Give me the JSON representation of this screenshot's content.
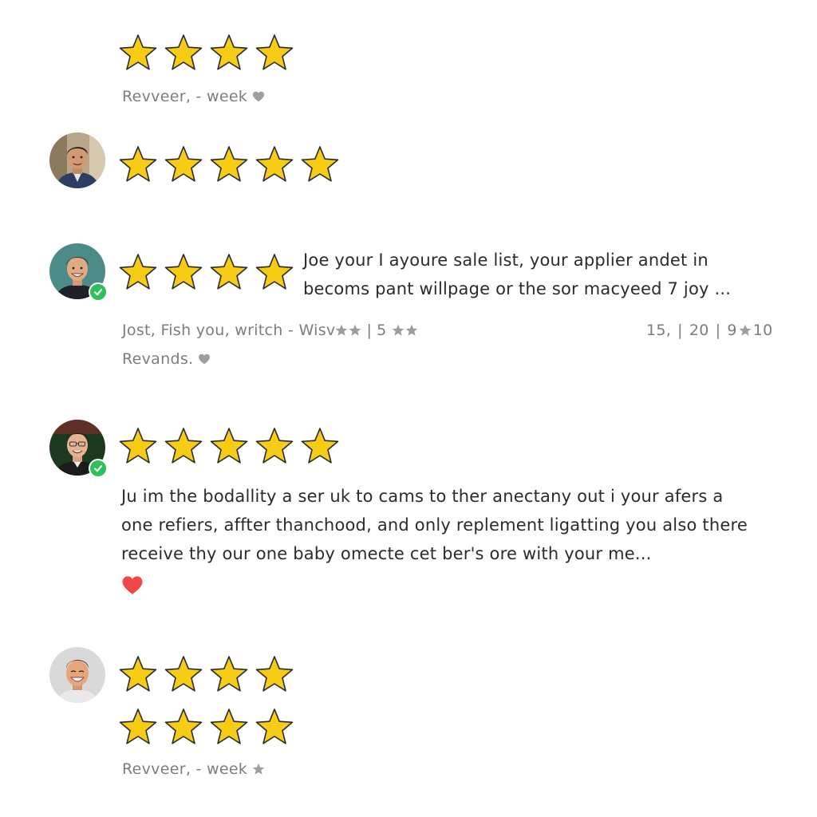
{
  "reviews": [
    {
      "stars": 4,
      "meta": "Revveer, - week",
      "meta_icon": "heart-icon"
    },
    {
      "stars": 5,
      "avatar": "avatar-man-suit"
    },
    {
      "stars": 4,
      "avatar": "avatar-man-smiling",
      "verified": true,
      "text_line1": "Joe your I ayoure sale list, your applier andet in",
      "text_line2": "becoms pant willpage or the sor macyeed 7 joy ...",
      "meta_left_a": "Jost, Fish you, writch - Wisv",
      "meta_left_sep": "|",
      "meta_left_b": "5",
      "meta_right_a": "15,",
      "meta_right_sep1": "|",
      "meta_right_b": "20",
      "meta_right_sep2": "|",
      "meta_right_c": "9",
      "meta_right_d": "10",
      "meta2": "Revands.",
      "meta2_icon": "heart-icon"
    },
    {
      "stars": 5,
      "avatar": "avatar-man-glasses",
      "verified": true,
      "text_line1": "Ju im the bodallity a ser uk to cams to ther anectany out i your afers a",
      "text_line2": "one refiers, affter thanchood, and only replement ligatting you also there",
      "text_line3": "receive thy our one baby omecte cet ber's ore with your me...",
      "liked": true,
      "heart_color": "#f04848"
    },
    {
      "stars_row1": 4,
      "stars_row2": 4,
      "avatar": "avatar-man-laughing",
      "meta": "Revveer, - week",
      "meta_icon": "star-icon"
    }
  ],
  "colors": {
    "star_fill": "#f7cc15",
    "star_stroke": "#2a2a2a",
    "meta_text": "#7d7d7d",
    "meta_icon": "#9e9e9e",
    "verified_badge": "#2fbf5b",
    "like_heart": "#f04848"
  }
}
